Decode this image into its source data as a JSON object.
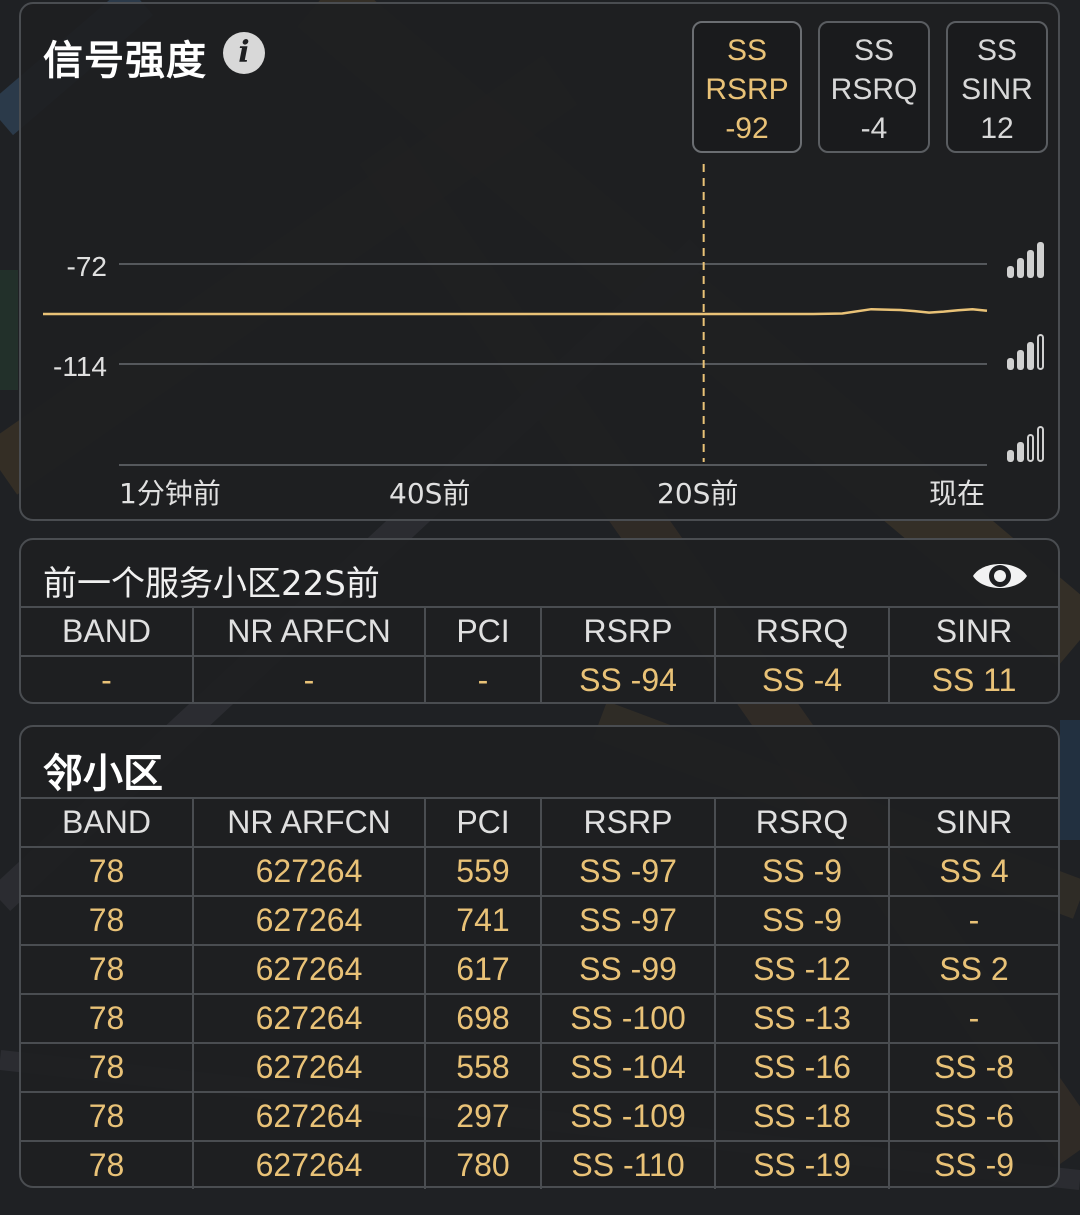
{
  "colors": {
    "accent": "#e9c277",
    "text": "#e0e0e0",
    "card_bg": "#1e1f21",
    "border": "#4a4d51"
  },
  "signal": {
    "title": "信号强度",
    "info_icon": "info-icon",
    "metrics": [
      {
        "line1": "SS",
        "line2": "RSRP",
        "value": "-92",
        "selected": true
      },
      {
        "line1": "SS",
        "line2": "RSRQ",
        "value": "-4",
        "selected": false
      },
      {
        "line1": "SS",
        "line2": "SINR",
        "value": "12",
        "selected": false
      }
    ]
  },
  "chart_data": {
    "type": "line",
    "title": "",
    "xlabel": "",
    "ylabel": "",
    "y_tick_labels": [
      "-72",
      "-114"
    ],
    "x_tick_labels": [
      "1分钟前",
      "40S前",
      "20S前",
      "现在"
    ],
    "x_seconds_ago": [
      60,
      56,
      52,
      48,
      44,
      40,
      36,
      32,
      28,
      24,
      20,
      16,
      12,
      10,
      8,
      6,
      5,
      4,
      3,
      2,
      1.5,
      1,
      0
    ],
    "y_values": [
      -93,
      -93,
      -93,
      -93,
      -93,
      -93,
      -93,
      -93,
      -93,
      -93,
      -93,
      -93,
      -93,
      -92.8,
      -91,
      -91.3,
      -91.8,
      -92.4,
      -92,
      -91.4,
      -91.2,
      -91,
      -91.6
    ],
    "series": [
      {
        "values": [
          -93,
          -93,
          -93,
          -93,
          -93,
          -93,
          -93,
          -93,
          -93,
          -93,
          -93,
          -93,
          -93,
          -92.8,
          -91,
          -91.3,
          -91.8,
          -92.4,
          -92,
          -91.4,
          -91.2,
          -91,
          -91.6
        ]
      }
    ],
    "marker_x_seconds_ago": 20,
    "ylim": [
      -156,
      -72
    ],
    "grid": true,
    "color": "#e9c277",
    "side_icons": [
      "signal-strong-icon",
      "signal-medium-icon",
      "signal-weak-icon"
    ]
  },
  "previous_cell": {
    "title": "前一个服务小区22S前",
    "eye_icon": "eye-icon",
    "headers": [
      "BAND",
      "NR ARFCN",
      "PCI",
      "RSRP",
      "RSRQ",
      "SINR"
    ],
    "row": [
      "-",
      "-",
      "-",
      "SS -94",
      "SS -4",
      "SS 11"
    ]
  },
  "neighbors": {
    "title": "邻小区",
    "headers": [
      "BAND",
      "NR ARFCN",
      "PCI",
      "RSRP",
      "RSRQ",
      "SINR"
    ],
    "rows": [
      [
        "78",
        "627264",
        "559",
        "SS -97",
        "SS -9",
        "SS 4"
      ],
      [
        "78",
        "627264",
        "741",
        "SS -97",
        "SS -9",
        "-"
      ],
      [
        "78",
        "627264",
        "617",
        "SS -99",
        "SS -12",
        "SS 2"
      ],
      [
        "78",
        "627264",
        "698",
        "SS -100",
        "SS -13",
        "-"
      ],
      [
        "78",
        "627264",
        "558",
        "SS -104",
        "SS -16",
        "SS -8"
      ],
      [
        "78",
        "627264",
        "297",
        "SS -109",
        "SS -18",
        "SS -6"
      ],
      [
        "78",
        "627264",
        "780",
        "SS -110",
        "SS -19",
        "SS -9"
      ]
    ]
  }
}
